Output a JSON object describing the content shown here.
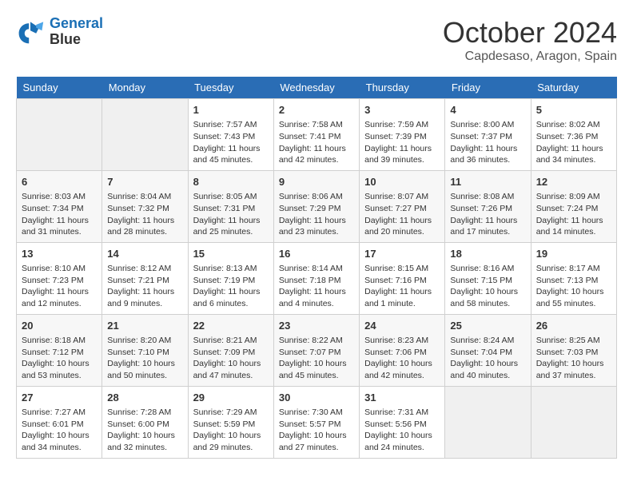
{
  "header": {
    "logo_line1": "General",
    "logo_line2": "Blue",
    "month": "October 2024",
    "location": "Capdesaso, Aragon, Spain"
  },
  "days_of_week": [
    "Sunday",
    "Monday",
    "Tuesday",
    "Wednesday",
    "Thursday",
    "Friday",
    "Saturday"
  ],
  "weeks": [
    [
      {
        "day": "",
        "content": ""
      },
      {
        "day": "",
        "content": ""
      },
      {
        "day": "1",
        "content": "Sunrise: 7:57 AM\nSunset: 7:43 PM\nDaylight: 11 hours and 45 minutes."
      },
      {
        "day": "2",
        "content": "Sunrise: 7:58 AM\nSunset: 7:41 PM\nDaylight: 11 hours and 42 minutes."
      },
      {
        "day": "3",
        "content": "Sunrise: 7:59 AM\nSunset: 7:39 PM\nDaylight: 11 hours and 39 minutes."
      },
      {
        "day": "4",
        "content": "Sunrise: 8:00 AM\nSunset: 7:37 PM\nDaylight: 11 hours and 36 minutes."
      },
      {
        "day": "5",
        "content": "Sunrise: 8:02 AM\nSunset: 7:36 PM\nDaylight: 11 hours and 34 minutes."
      }
    ],
    [
      {
        "day": "6",
        "content": "Sunrise: 8:03 AM\nSunset: 7:34 PM\nDaylight: 11 hours and 31 minutes."
      },
      {
        "day": "7",
        "content": "Sunrise: 8:04 AM\nSunset: 7:32 PM\nDaylight: 11 hours and 28 minutes."
      },
      {
        "day": "8",
        "content": "Sunrise: 8:05 AM\nSunset: 7:31 PM\nDaylight: 11 hours and 25 minutes."
      },
      {
        "day": "9",
        "content": "Sunrise: 8:06 AM\nSunset: 7:29 PM\nDaylight: 11 hours and 23 minutes."
      },
      {
        "day": "10",
        "content": "Sunrise: 8:07 AM\nSunset: 7:27 PM\nDaylight: 11 hours and 20 minutes."
      },
      {
        "day": "11",
        "content": "Sunrise: 8:08 AM\nSunset: 7:26 PM\nDaylight: 11 hours and 17 minutes."
      },
      {
        "day": "12",
        "content": "Sunrise: 8:09 AM\nSunset: 7:24 PM\nDaylight: 11 hours and 14 minutes."
      }
    ],
    [
      {
        "day": "13",
        "content": "Sunrise: 8:10 AM\nSunset: 7:23 PM\nDaylight: 11 hours and 12 minutes."
      },
      {
        "day": "14",
        "content": "Sunrise: 8:12 AM\nSunset: 7:21 PM\nDaylight: 11 hours and 9 minutes."
      },
      {
        "day": "15",
        "content": "Sunrise: 8:13 AM\nSunset: 7:19 PM\nDaylight: 11 hours and 6 minutes."
      },
      {
        "day": "16",
        "content": "Sunrise: 8:14 AM\nSunset: 7:18 PM\nDaylight: 11 hours and 4 minutes."
      },
      {
        "day": "17",
        "content": "Sunrise: 8:15 AM\nSunset: 7:16 PM\nDaylight: 11 hours and 1 minute."
      },
      {
        "day": "18",
        "content": "Sunrise: 8:16 AM\nSunset: 7:15 PM\nDaylight: 10 hours and 58 minutes."
      },
      {
        "day": "19",
        "content": "Sunrise: 8:17 AM\nSunset: 7:13 PM\nDaylight: 10 hours and 55 minutes."
      }
    ],
    [
      {
        "day": "20",
        "content": "Sunrise: 8:18 AM\nSunset: 7:12 PM\nDaylight: 10 hours and 53 minutes."
      },
      {
        "day": "21",
        "content": "Sunrise: 8:20 AM\nSunset: 7:10 PM\nDaylight: 10 hours and 50 minutes."
      },
      {
        "day": "22",
        "content": "Sunrise: 8:21 AM\nSunset: 7:09 PM\nDaylight: 10 hours and 47 minutes."
      },
      {
        "day": "23",
        "content": "Sunrise: 8:22 AM\nSunset: 7:07 PM\nDaylight: 10 hours and 45 minutes."
      },
      {
        "day": "24",
        "content": "Sunrise: 8:23 AM\nSunset: 7:06 PM\nDaylight: 10 hours and 42 minutes."
      },
      {
        "day": "25",
        "content": "Sunrise: 8:24 AM\nSunset: 7:04 PM\nDaylight: 10 hours and 40 minutes."
      },
      {
        "day": "26",
        "content": "Sunrise: 8:25 AM\nSunset: 7:03 PM\nDaylight: 10 hours and 37 minutes."
      }
    ],
    [
      {
        "day": "27",
        "content": "Sunrise: 7:27 AM\nSunset: 6:01 PM\nDaylight: 10 hours and 34 minutes."
      },
      {
        "day": "28",
        "content": "Sunrise: 7:28 AM\nSunset: 6:00 PM\nDaylight: 10 hours and 32 minutes."
      },
      {
        "day": "29",
        "content": "Sunrise: 7:29 AM\nSunset: 5:59 PM\nDaylight: 10 hours and 29 minutes."
      },
      {
        "day": "30",
        "content": "Sunrise: 7:30 AM\nSunset: 5:57 PM\nDaylight: 10 hours and 27 minutes."
      },
      {
        "day": "31",
        "content": "Sunrise: 7:31 AM\nSunset: 5:56 PM\nDaylight: 10 hours and 24 minutes."
      },
      {
        "day": "",
        "content": ""
      },
      {
        "day": "",
        "content": ""
      }
    ]
  ]
}
